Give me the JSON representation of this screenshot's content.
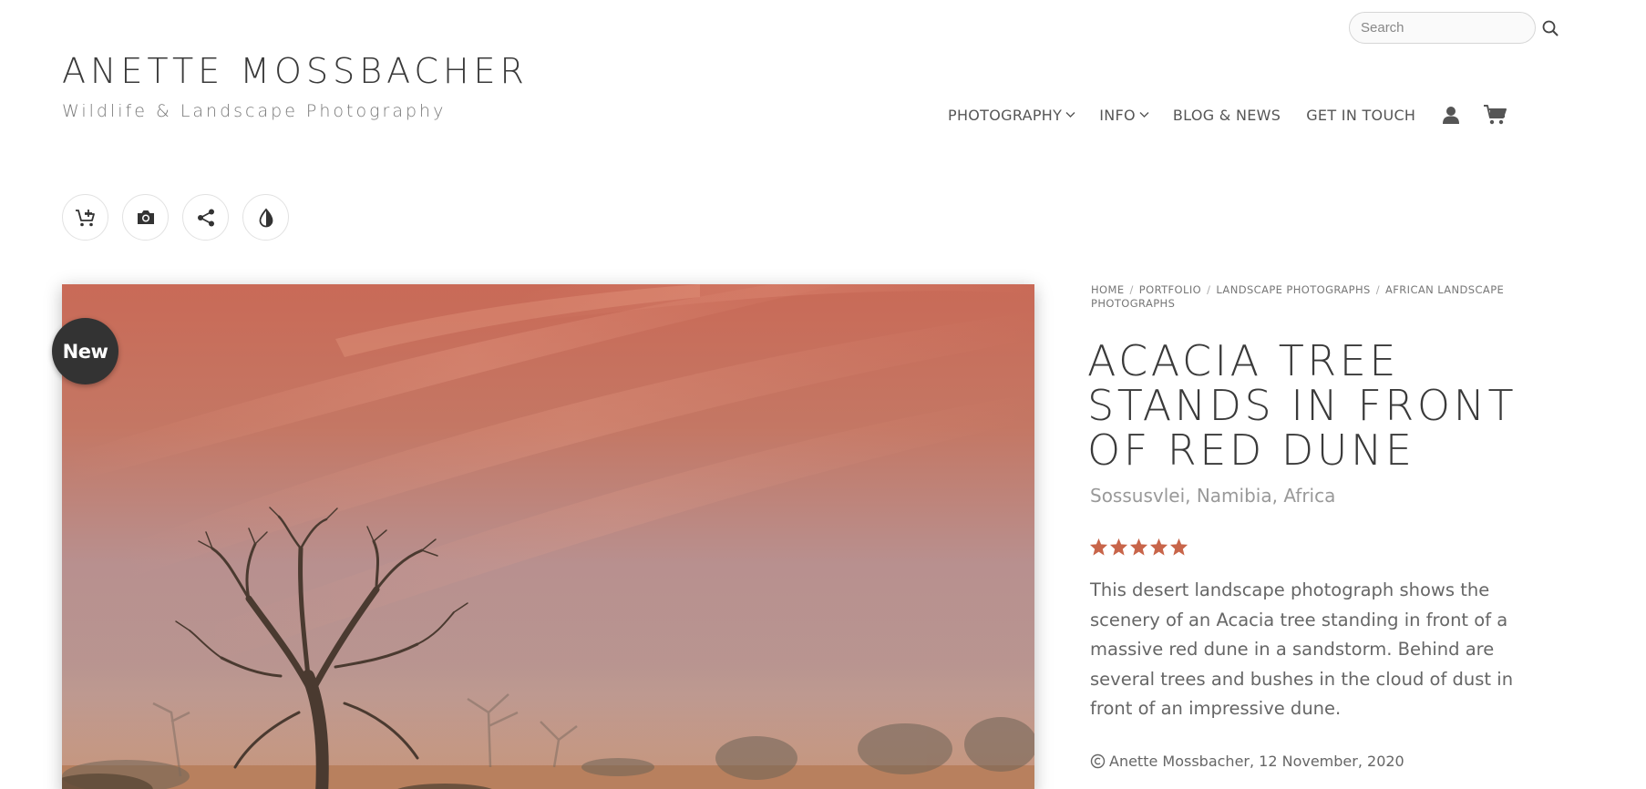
{
  "search": {
    "placeholder": "Search"
  },
  "brand": {
    "name": "ANETTE MOSSBACHER",
    "tagline": "Wildlife & Landscape Photography"
  },
  "nav": {
    "items": [
      {
        "label": "PHOTOGRAPHY",
        "has_dropdown": true
      },
      {
        "label": "INFO",
        "has_dropdown": true
      },
      {
        "label": "BLOG & NEWS",
        "has_dropdown": false
      },
      {
        "label": "GET IN TOUCH",
        "has_dropdown": false
      }
    ],
    "icons": [
      "user-icon",
      "cart-icon"
    ]
  },
  "tools": [
    "add-to-cart-icon",
    "camera-icon",
    "share-icon",
    "contrast-icon"
  ],
  "photo": {
    "badge": "New"
  },
  "breadcrumb": [
    "HOME",
    "PORTFOLIO",
    "LANDSCAPE PHOTOGRAPHS",
    "AFRICAN LANDSCAPE PHOTOGRAPHS"
  ],
  "product": {
    "title": "ACACIA TREE STANDS IN FRONT OF RED DUNE",
    "location": "Sossusvlei, Namibia, Africa",
    "rating": 5,
    "rating_max": 5,
    "description": "This desert landscape photograph shows the scenery of an Acacia tree standing in front of a massive red dune in a sandstorm. Behind are several trees and bushes in the cloud of dust in front of an impressive dune.",
    "copyright": "Anette Mossbacher, 12 November, 2020"
  },
  "colors": {
    "star": "#c8654a",
    "badge_bg": "#333333",
    "text_dark": "#3a3a3a"
  }
}
